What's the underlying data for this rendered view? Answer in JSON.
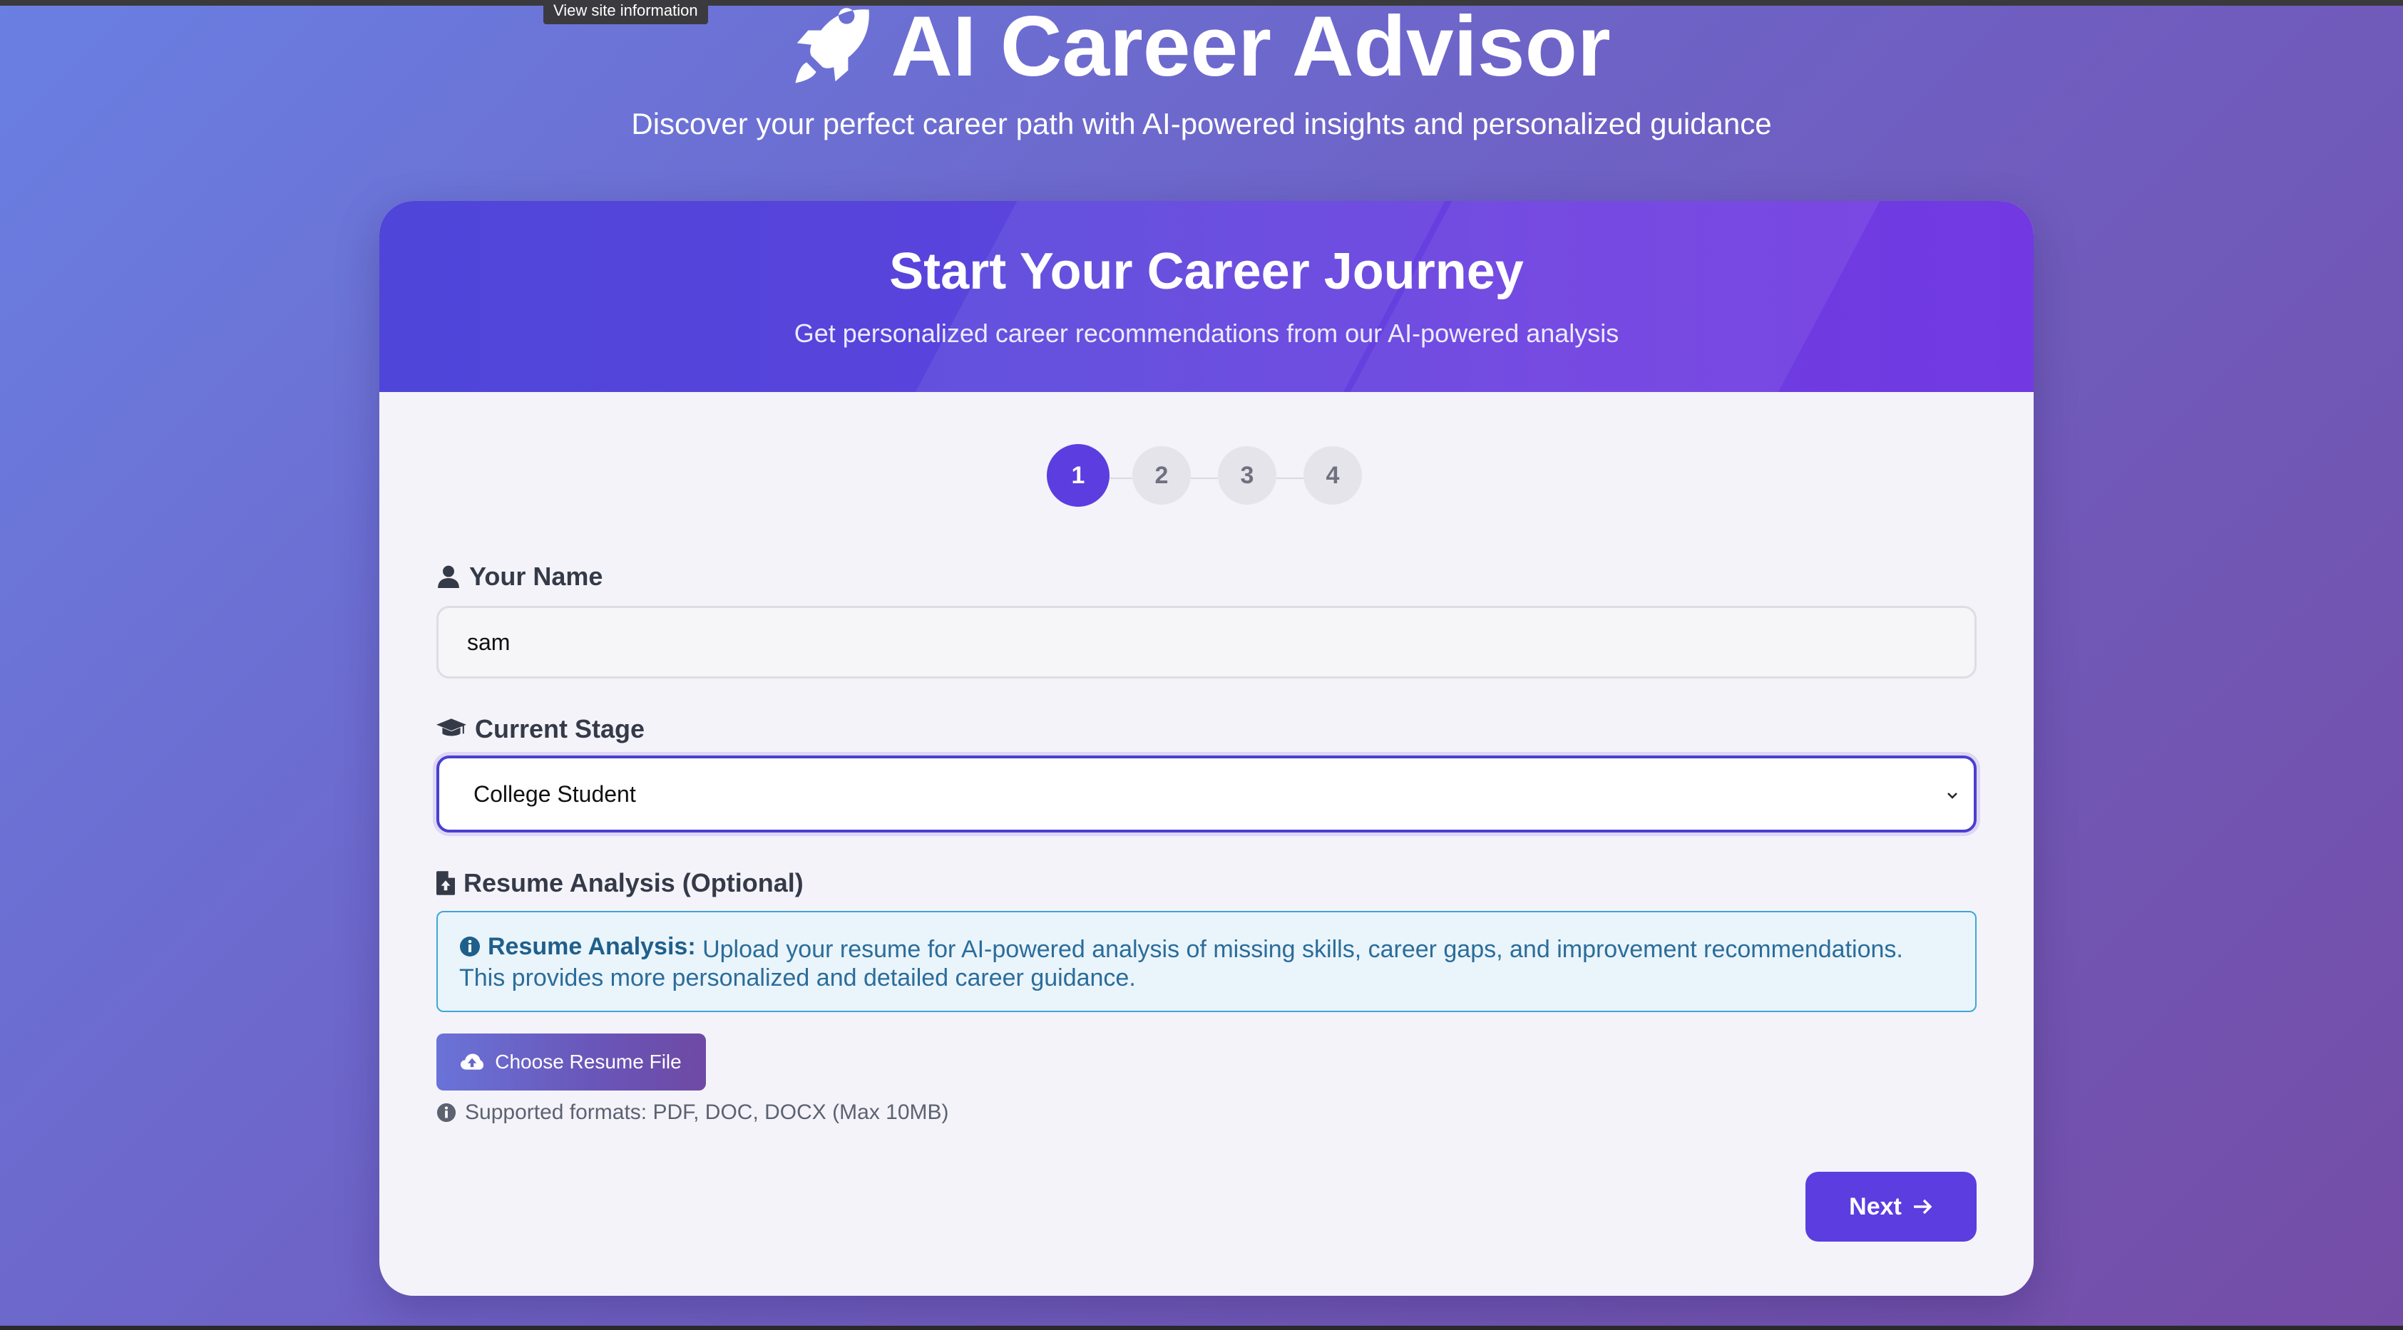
{
  "browser": {
    "tooltip": "View site information"
  },
  "header": {
    "app_title": "AI Career Advisor",
    "subtitle": "Discover your perfect career path with AI-powered insights and personalized guidance"
  },
  "card": {
    "title": "Start Your Career Journey",
    "subtitle": "Get personalized career recommendations from our AI-powered analysis"
  },
  "steps": {
    "current": 1,
    "items": [
      "1",
      "2",
      "3",
      "4"
    ]
  },
  "form": {
    "name_label": "Your Name",
    "name_value": "sam",
    "stage_label": "Current Stage",
    "stage_value": "College Student",
    "resume_label": "Resume Analysis (Optional)",
    "info_lead": "Resume Analysis:",
    "info_text": "Upload your resume for AI-powered analysis of missing skills, career gaps, and improvement recommendations. This provides more personalized and detailed career guidance.",
    "choose_button": "Choose Resume File",
    "formats_note": "Supported formats: PDF, DOC, DOCX (Max 10MB)",
    "next_button": "Next"
  },
  "colors": {
    "accent": "#5b3de0",
    "info_border": "#3da7d6",
    "info_text": "#2a6d9a"
  },
  "icons": [
    "rocket-icon",
    "user-icon",
    "graduation-cap-icon",
    "file-upload-icon",
    "info-circle-icon",
    "cloud-upload-icon",
    "arrow-right-icon",
    "chevron-down-icon"
  ]
}
